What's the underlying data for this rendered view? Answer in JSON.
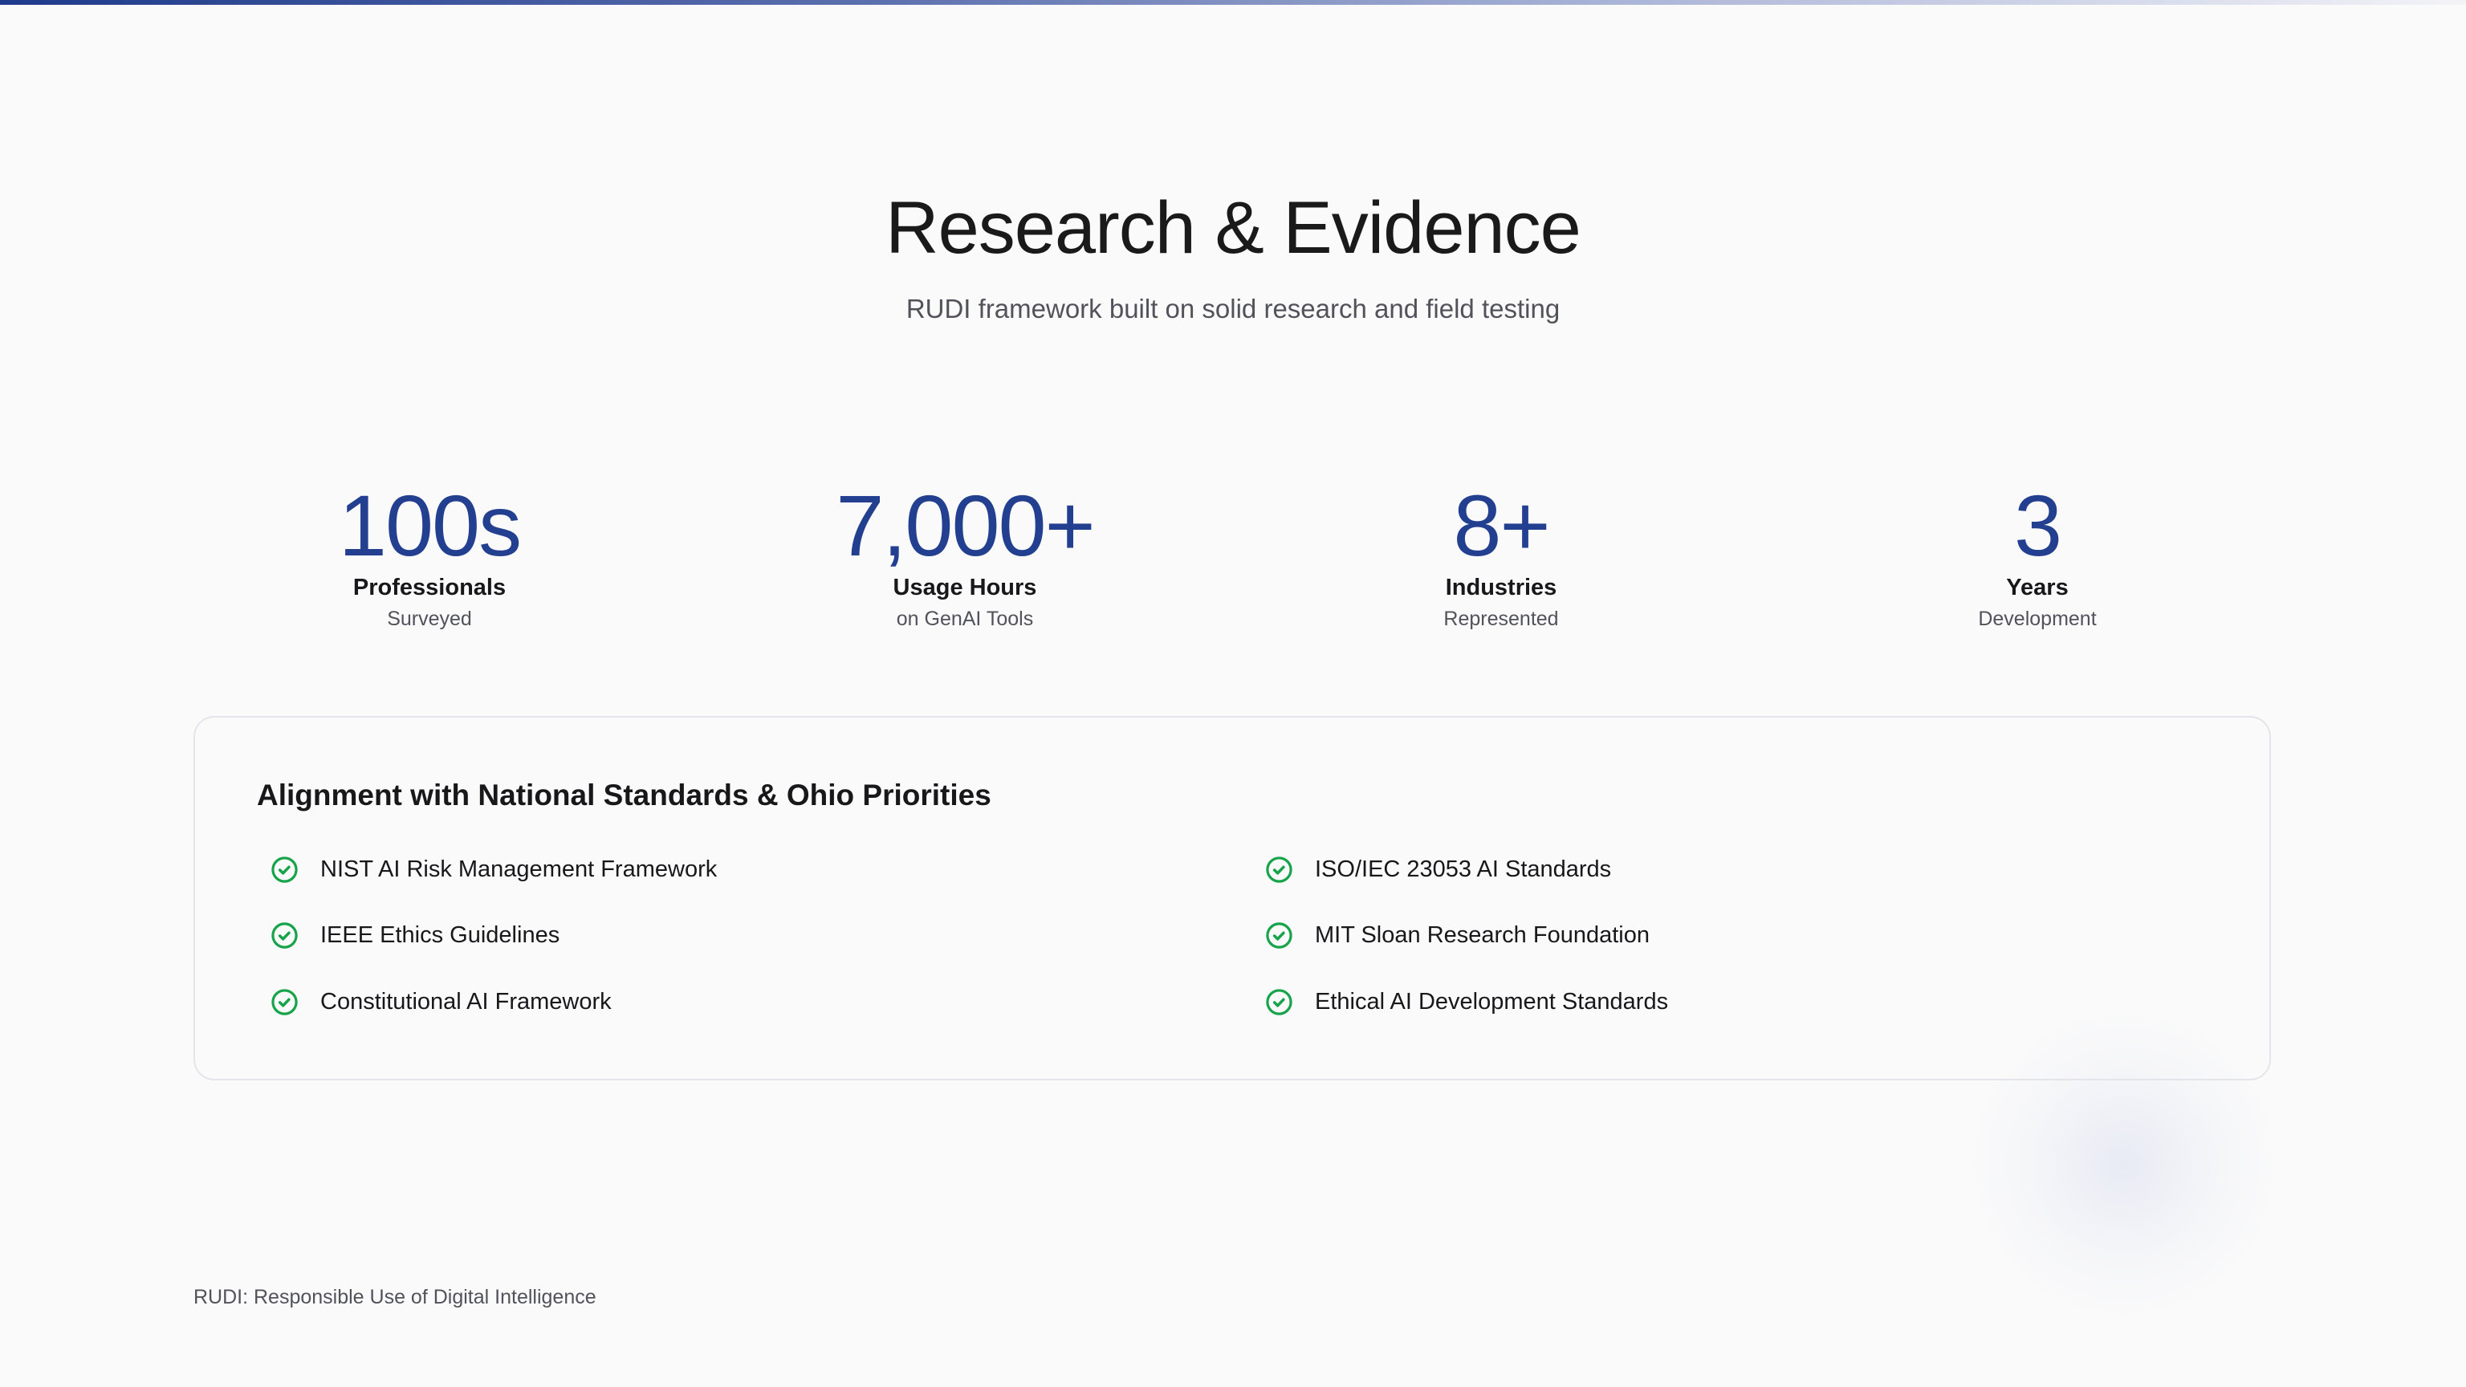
{
  "header": {
    "title": "Research & Evidence",
    "subtitle": "RUDI framework built on solid research and field testing"
  },
  "stats": [
    {
      "value": "100s",
      "label": "Professionals",
      "sublabel": "Surveyed"
    },
    {
      "value": "7,000+",
      "label": "Usage Hours",
      "sublabel": "on GenAI Tools"
    },
    {
      "value": "8+",
      "label": "Industries",
      "sublabel": "Represented"
    },
    {
      "value": "3",
      "label": "Years",
      "sublabel": "Development"
    }
  ],
  "alignment": {
    "heading": "Alignment with National Standards & Ohio Priorities",
    "items": [
      "NIST AI Risk Management Framework",
      "IEEE Ethics Guidelines",
      "Constitutional AI Framework",
      "ISO/IEC 23053 AI Standards",
      "MIT Sloan Research Foundation",
      "Ethical AI Development Standards"
    ],
    "icon": "check-circle-icon",
    "icon_color": "#16a34a"
  },
  "footer": {
    "text": "RUDI: Responsible Use of Digital Intelligence"
  },
  "colors": {
    "accent": "#233f8f",
    "check": "#16a34a"
  }
}
